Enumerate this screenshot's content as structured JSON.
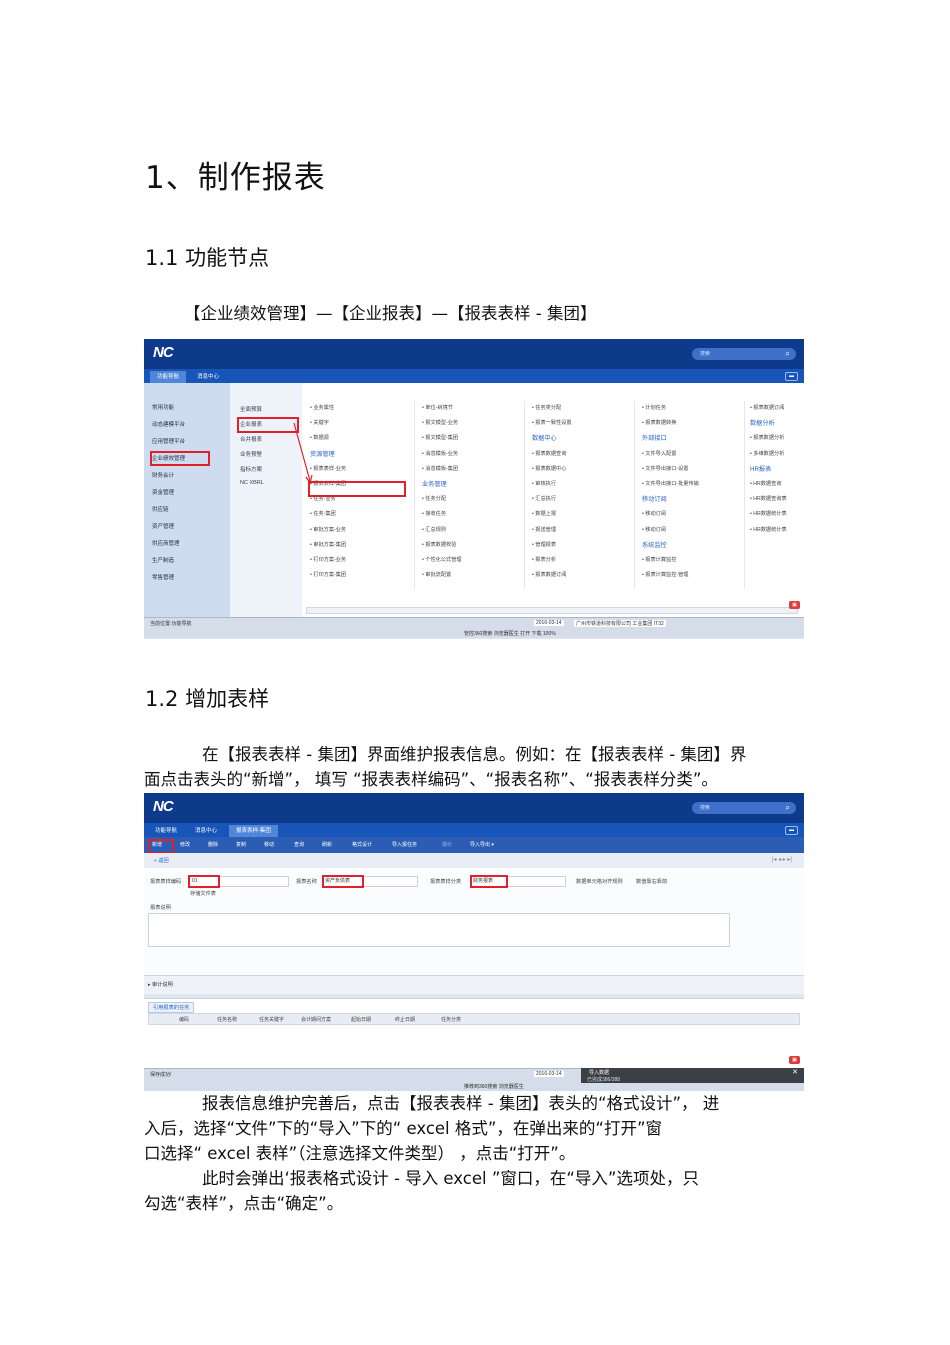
{
  "doc": {
    "h1": "1、制作报表",
    "h2_1": "1.1  功能节点",
    "path": "【企业绩效管理】—【企业报表】—【报表表样      - 集团】",
    "h2_2": "1.2  增加表样",
    "para1_l1": "在【报表表样 - 集团】界面维护报表信息。例如：在【报表表样      - 集团】界",
    "para1_l2": "面点击表头的“新增”， 填写 “报表表样编码”、“报表名称”、“报表表样分类”。",
    "para2_l1": "报表信息维护完善后，点击【报表表样      - 集团】表头的“格式设计”， 进",
    "para2_l2": "入后，选择“文件”下的“导入”下的“      excel 格式”，在弹出来的“打开”窗",
    "para2_l3": "口选择“ excel  表样”（注意选择文件类型） ，点击“打开”。",
    "para3_l1": "此时会弹出‘报表格式设计      - 导入  excel ”窗口，在“导入”选项处，只",
    "para3_l2": "勾选“表样”，点击“确定”。"
  },
  "shot1": {
    "logo": "NC",
    "search_placeholder": "搜索",
    "tabs": [
      "功能导航",
      "消息中心"
    ],
    "sidebar": [
      "常用功能",
      "动态建模平台",
      "应用管理平台",
      "企业绩效管理",
      "财务会计",
      "资金管理",
      "供应链",
      "资产管理",
      "供应商管理",
      "生产制造",
      "零售管理"
    ],
    "submenu": [
      "全面预算",
      "企业报表",
      "合并报表",
      "业务预警",
      "指标方案",
      "NC XBRL"
    ],
    "col1": [
      {
        "t": "i",
        "s": "业务属性"
      },
      {
        "t": "i",
        "s": "关键字"
      },
      {
        "t": "i",
        "s": "数据源"
      },
      {
        "t": "h",
        "s": "资源管理"
      },
      {
        "t": "i",
        "s": "报表表样-业务"
      },
      {
        "t": "i",
        "s": "报表表样-集团"
      },
      {
        "t": "i",
        "s": "任务-业务"
      },
      {
        "t": "i",
        "s": "任务-集团"
      },
      {
        "t": "i",
        "s": "审批方案-业务"
      },
      {
        "t": "i",
        "s": "审批方案-集团"
      },
      {
        "t": "i",
        "s": "打印方案-业务"
      },
      {
        "t": "i",
        "s": "打印方案-集团"
      }
    ],
    "col2": [
      {
        "t": "i",
        "s": "单位-树境节"
      },
      {
        "t": "i",
        "s": "报文模型-业务"
      },
      {
        "t": "i",
        "s": "报文模型-集团"
      },
      {
        "t": "i",
        "s": "消息模板-业务"
      },
      {
        "t": "i",
        "s": "消息模板-集团"
      },
      {
        "t": "h",
        "s": "业务管理"
      },
      {
        "t": "i",
        "s": "任务分配"
      },
      {
        "t": "i",
        "s": "接收任务"
      },
      {
        "t": "i",
        "s": "汇总规则"
      },
      {
        "t": "i",
        "s": "报表数据校验"
      },
      {
        "t": "i",
        "s": "个性化公式管理"
      },
      {
        "t": "i",
        "s": "审批流配置"
      }
    ],
    "col3": [
      {
        "t": "i",
        "s": "任务类分配"
      },
      {
        "t": "i",
        "s": "报表一致性设置"
      },
      {
        "t": "h",
        "s": "数据中心"
      },
      {
        "t": "i",
        "s": "报表数据查询"
      },
      {
        "t": "i",
        "s": "报表数据中心"
      },
      {
        "t": "i",
        "s": "审核执行"
      },
      {
        "t": "i",
        "s": "汇总执行"
      },
      {
        "t": "i",
        "s": "数据上报"
      },
      {
        "t": "i",
        "s": "报送管理"
      },
      {
        "t": "i",
        "s": "管理报表"
      },
      {
        "t": "i",
        "s": "报表分析"
      },
      {
        "t": "i",
        "s": "报表数据订阅"
      }
    ],
    "col4": [
      {
        "t": "i",
        "s": "计划任务"
      },
      {
        "t": "i",
        "s": "报表数据转换"
      },
      {
        "t": "h",
        "s": "外部接口"
      },
      {
        "t": "i",
        "s": "文件导入配置"
      },
      {
        "t": "i",
        "s": "文件导出接口-设置"
      },
      {
        "t": "i",
        "s": "文件导出接口-批量传输"
      },
      {
        "t": "h",
        "s": "移动订阅"
      },
      {
        "t": "i",
        "s": "移动订阅"
      },
      {
        "t": "i",
        "s": "移动订阅"
      },
      {
        "t": "h",
        "s": "系统监控"
      },
      {
        "t": "i",
        "s": "报表计算监控"
      },
      {
        "t": "i",
        "s": "报表计算监控-管理"
      }
    ],
    "col5": [
      {
        "t": "i",
        "s": "报表数据订阅"
      },
      {
        "t": "h",
        "s": "数据分析"
      },
      {
        "t": "i",
        "s": "报表数据分析"
      },
      {
        "t": "i",
        "s": "多维数据分析"
      },
      {
        "t": "h",
        "s": "HR报表"
      },
      {
        "t": "i",
        "s": "HR数据查询"
      },
      {
        "t": "i",
        "s": "HR数据查询表"
      },
      {
        "t": "i",
        "s": "HR数据统计表"
      },
      {
        "t": "i",
        "s": "HR数据统计表"
      }
    ],
    "status_left": "当前位置:功能导航",
    "status_date": "2016-03-14",
    "status_company": "广州市铁道科技有限公司  工业集团 IT32",
    "status_bottom": "管控360搜索    浏览器医生    打开    下载    100%"
  },
  "shot2": {
    "logo": "NC",
    "search_placeholder": "搜索",
    "tabs": [
      "功能导航",
      "消息中心",
      "报表表样-集团"
    ],
    "toolbar": [
      "新增",
      "修改",
      "删除",
      "复制",
      "移动",
      "查询",
      "刷新",
      "格式设计",
      "导入报任务",
      "报价",
      "导入导出 ▾"
    ],
    "back": "« 返回",
    "code_label": "报表表样编码",
    "code_value": "01",
    "name_label": "报表名称",
    "name_value": "资产负债表",
    "cat_label": "报表表样分类",
    "cat_value": "财务报表",
    "unit_label": "数据单元格对齐规则",
    "unit_value": "数值靠右靠前",
    "has_file": "存储文件表",
    "desc_label": "报表说明",
    "audit_label": "▸ 审计说明",
    "tasktab": "引用报表的任务",
    "grid_cols": [
      "编码",
      "任务名称",
      "任务关键字",
      "会计期间方案",
      "起始日期",
      "终止日期",
      "任务分类"
    ],
    "status_left": "保存成功!",
    "status_date": "2016-03-14",
    "popup_title": "导入数据",
    "popup_text": "已完成386/388",
    "status_bottom": "推荐到360搜索    浏览器医生"
  }
}
